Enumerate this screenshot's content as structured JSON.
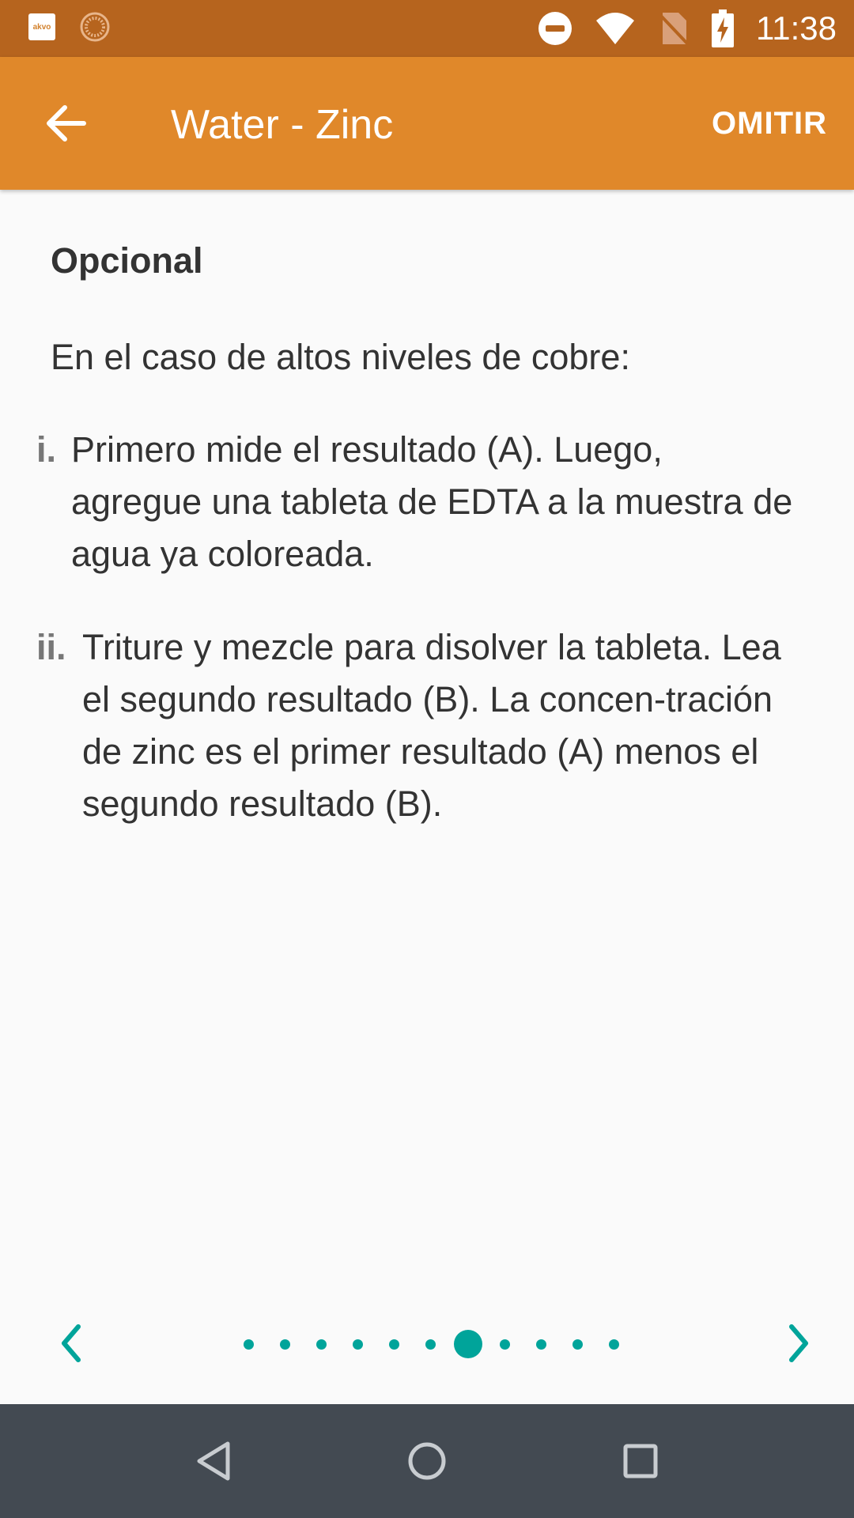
{
  "status_bar": {
    "app_badge_text": "akvo",
    "time": "11:38",
    "icons": [
      "akvo-app-icon",
      "loading-spinner-icon",
      "do-not-disturb-icon",
      "wifi-icon",
      "no-sim-icon",
      "battery-charging-icon"
    ]
  },
  "app_bar": {
    "back_icon": "arrow-back-icon",
    "title": "Water - Zinc",
    "skip_label": "OMITIR"
  },
  "content": {
    "heading": "Opcional",
    "intro": "En el caso de altos niveles de cobre:",
    "steps": [
      {
        "marker": "i.",
        "text": "Primero mide el resultado (A). Luego, agregue una tableta de EDTA a la muestra de agua ya coloreada."
      },
      {
        "marker": "ii.",
        "text": "Triture y mezcle para disolver la tableta. Lea el segundo resultado (B). La concen-tración de zinc es el primer resultado (A) menos el segundo resultado (B)."
      }
    ]
  },
  "pager": {
    "prev_icon": "chevron-left-icon",
    "next_icon": "chevron-right-icon",
    "total_pages": 11,
    "current_page": 7,
    "accent_color": "#00A49A"
  },
  "colors": {
    "status_bar": "#B6641E",
    "app_bar": "#E0882A",
    "nav_bar": "#434A52"
  },
  "nav_bar": {
    "icons": [
      "back-triangle-icon",
      "home-circle-icon",
      "recents-square-icon"
    ]
  }
}
